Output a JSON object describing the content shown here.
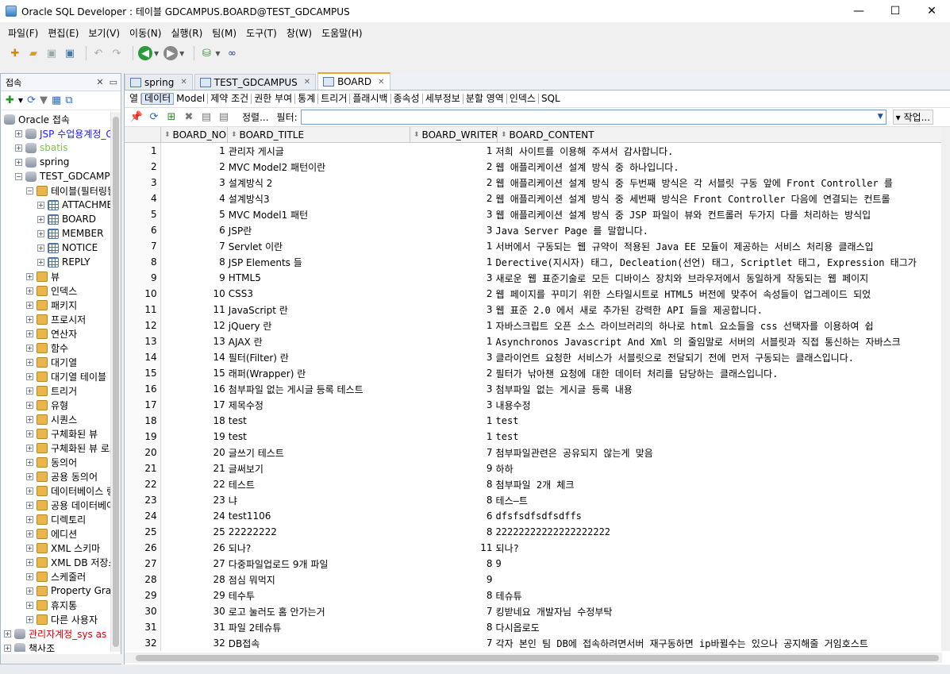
{
  "window": {
    "title": "Oracle SQL Developer : 테이블 GDCAMPUS.BOARD@TEST_GDCAMPUS",
    "minimize": "—",
    "maximize": "☐",
    "close": "✕"
  },
  "menu": [
    "파일(F)",
    "편집(E)",
    "보기(V)",
    "이동(N)",
    "실행(R)",
    "팀(M)",
    "도구(T)",
    "창(W)",
    "도움말(H)"
  ],
  "sidebar": {
    "title": "접속",
    "tree": [
      {
        "label": "Oracle 접속",
        "indent": 0,
        "icon": "db",
        "toggle": "",
        "color": "#000"
      },
      {
        "label": "JSP 수업용계정_GD",
        "indent": 1,
        "icon": "db",
        "toggle": "+",
        "color": "#1a1aff"
      },
      {
        "label": "sbatis",
        "indent": 1,
        "icon": "db",
        "toggle": "+",
        "color": "#7cc24a"
      },
      {
        "label": "spring",
        "indent": 1,
        "icon": "db",
        "toggle": "+",
        "color": "#000"
      },
      {
        "label": "TEST_GDCAMPUS",
        "indent": 1,
        "icon": "db",
        "toggle": "−",
        "color": "#000"
      },
      {
        "label": "테이블(필터링됨)",
        "indent": 2,
        "icon": "folder",
        "toggle": "−",
        "color": "#000"
      },
      {
        "label": "ATTACHMENT",
        "indent": 3,
        "icon": "table",
        "toggle": "+",
        "color": "#000"
      },
      {
        "label": "BOARD",
        "indent": 3,
        "icon": "table",
        "toggle": "+",
        "color": "#000"
      },
      {
        "label": "MEMBER",
        "indent": 3,
        "icon": "table",
        "toggle": "+",
        "color": "#000"
      },
      {
        "label": "NOTICE",
        "indent": 3,
        "icon": "table",
        "toggle": "+",
        "color": "#000"
      },
      {
        "label": "REPLY",
        "indent": 3,
        "icon": "table",
        "toggle": "+",
        "color": "#000"
      },
      {
        "label": "뷰",
        "indent": 2,
        "icon": "folder",
        "toggle": "+",
        "color": "#000"
      },
      {
        "label": "인덱스",
        "indent": 2,
        "icon": "folder",
        "toggle": "+",
        "color": "#000"
      },
      {
        "label": "패키지",
        "indent": 2,
        "icon": "folder",
        "toggle": "+",
        "color": "#000"
      },
      {
        "label": "프로시저",
        "indent": 2,
        "icon": "folder",
        "toggle": "+",
        "color": "#000"
      },
      {
        "label": "연산자",
        "indent": 2,
        "icon": "folder",
        "toggle": "+",
        "color": "#000"
      },
      {
        "label": "함수",
        "indent": 2,
        "icon": "folder",
        "toggle": "+",
        "color": "#000"
      },
      {
        "label": "대기열",
        "indent": 2,
        "icon": "folder",
        "toggle": "+",
        "color": "#000"
      },
      {
        "label": "대기열 테이블",
        "indent": 2,
        "icon": "folder",
        "toggle": "+",
        "color": "#000"
      },
      {
        "label": "트리거",
        "indent": 2,
        "icon": "folder",
        "toggle": "+",
        "color": "#000"
      },
      {
        "label": "유형",
        "indent": 2,
        "icon": "folder",
        "toggle": "+",
        "color": "#000"
      },
      {
        "label": "시퀀스",
        "indent": 2,
        "icon": "folder",
        "toggle": "+",
        "color": "#000"
      },
      {
        "label": "구체화된 뷰",
        "indent": 2,
        "icon": "folder",
        "toggle": "+",
        "color": "#000"
      },
      {
        "label": "구체화된 뷰 로그",
        "indent": 2,
        "icon": "folder",
        "toggle": "+",
        "color": "#000"
      },
      {
        "label": "동의어",
        "indent": 2,
        "icon": "folder",
        "toggle": "+",
        "color": "#000"
      },
      {
        "label": "공용 동의어",
        "indent": 2,
        "icon": "folder",
        "toggle": "+",
        "color": "#000"
      },
      {
        "label": "데이터베이스 링크",
        "indent": 2,
        "icon": "folder",
        "toggle": "+",
        "color": "#000"
      },
      {
        "label": "공용 데이터베이스",
        "indent": 2,
        "icon": "folder",
        "toggle": "+",
        "color": "#000"
      },
      {
        "label": "디렉토리",
        "indent": 2,
        "icon": "folder",
        "toggle": "+",
        "color": "#000"
      },
      {
        "label": "에디션",
        "indent": 2,
        "icon": "folder",
        "toggle": "+",
        "color": "#000"
      },
      {
        "label": "XML 스키마",
        "indent": 2,
        "icon": "folder",
        "toggle": "+",
        "color": "#000"
      },
      {
        "label": "XML DB 저장소",
        "indent": 2,
        "icon": "folder",
        "toggle": "+",
        "color": "#000"
      },
      {
        "label": "스케줄러",
        "indent": 2,
        "icon": "folder",
        "toggle": "+",
        "color": "#000"
      },
      {
        "label": "Property Graph",
        "indent": 2,
        "icon": "folder",
        "toggle": "+",
        "color": "#000"
      },
      {
        "label": "휴지통",
        "indent": 2,
        "icon": "folder",
        "toggle": "+",
        "color": "#000"
      },
      {
        "label": "다른 사용자",
        "indent": 2,
        "icon": "folder",
        "toggle": "+",
        "color": "#000"
      },
      {
        "label": "관리자계정_sys as",
        "indent": 0,
        "icon": "db",
        "toggle": "+",
        "color": "#e00000"
      },
      {
        "label": "책사조",
        "indent": 0,
        "icon": "db",
        "toggle": "+",
        "color": "#000"
      }
    ]
  },
  "doc_tabs": [
    {
      "label": "spring",
      "active": false
    },
    {
      "label": "TEST_GDCAMPUS",
      "active": false
    },
    {
      "label": "BOARD",
      "active": true
    }
  ],
  "sub_tabs": [
    "열",
    "데이터",
    "Model",
    "제약 조건",
    "권한 부여",
    "통계",
    "트리거",
    "플래시백",
    "종속성",
    "세부정보",
    "분할 영역",
    "인덱스",
    "SQL"
  ],
  "active_sub_tab": "데이터",
  "grid_toolbar": {
    "sort_label": "정렬...",
    "filter_label": "필터:",
    "filter_value": "",
    "job_label": "▾ 작업..."
  },
  "columns": [
    "",
    "BOARD_NO",
    "BOARD_TITLE",
    "BOARD_WRITER",
    "BOARD_CONTENT"
  ],
  "rows": [
    [
      "1",
      "1",
      "관리자 게시글",
      "1",
      "저희 사이트를 이용해 주셔서 감사합니다."
    ],
    [
      "2",
      "2",
      "MVC Model2 패턴이란",
      "2",
      "웹 애플리케이션 설계 방식 중 하나입니다."
    ],
    [
      "3",
      "3",
      "설계방식 2",
      "2",
      "웹 애플리케이션 설계 방식 중 두번째 방식은 각 서블릿 구동 앞에 Front Controller 를"
    ],
    [
      "4",
      "4",
      "설계방식3",
      "2",
      "웹 애플리케이션 설계 방식 중 세번째 방식은 Front Controller 다음에 연결되는 컨트롤"
    ],
    [
      "5",
      "5",
      "MVC Model1 패턴",
      "3",
      "웹 애플리케이션 설계 방식 중 JSP 파일이 뷰와 컨트롤러 두가지 다를 처리하는 방식입"
    ],
    [
      "6",
      "6",
      "JSP란",
      "3",
      "Java Server Page 를 말합니다."
    ],
    [
      "7",
      "7",
      "Servlet 이란",
      "1",
      "서버에서 구동되는 웹 규약이 적용된 Java EE 모듈이 제공하는 서비스 처리용 클래스입"
    ],
    [
      "8",
      "8",
      "JSP Elements 들",
      "1",
      "Derective(지시자) 태그, Decleation(선언) 태그, Scriptlet 태그, Expression 태그가"
    ],
    [
      "9",
      "9",
      "HTML5",
      "3",
      "새로운 웹 표준기술로 모든 디바이스 장치와 브라우저에서 동일하게 작동되는 웹 페이지"
    ],
    [
      "10",
      "10",
      "CSS3",
      "2",
      "웹 페이지를 꾸미기 위한 스타일시트로 HTML5 버전에 맞추어 속성들이 업그레이드 되었"
    ],
    [
      "11",
      "11",
      "JavaScript 란",
      "3",
      "웹 표준 2.0 에서 새로 추가된 강력한 API 들을 제공합니다."
    ],
    [
      "12",
      "12",
      "jQuery 란",
      "1",
      "자바스크립트 오픈 소스 라이브러리의 하나로 html 요소들을 css 선택자를 이용하여 쉽"
    ],
    [
      "13",
      "13",
      "AJAX 란",
      "1",
      "Asynchronos Javascript And Xml 의 줄임말로 서버의 서블릿과 직접 통신하는 자바스크"
    ],
    [
      "14",
      "14",
      "필터(Filter) 란",
      "3",
      "클라이언트 요청한 서비스가 서블릿으로 전달되기 전에 먼저 구동되는 클래스입니다."
    ],
    [
      "15",
      "15",
      "래퍼(Wrapper) 란",
      "2",
      "필터가 낚아챈 요청에 대한 데이터 처리를 담당하는 클래스입니다."
    ],
    [
      "16",
      "16",
      "첨부파일 없는 게시글 등록 테스트",
      "3",
      "첨부파일 없는 게시글 등록 내용"
    ],
    [
      "17",
      "17",
      "제목수정",
      "3",
      "내용수정"
    ],
    [
      "18",
      "18",
      "test",
      "1",
      "test"
    ],
    [
      "19",
      "19",
      "test",
      "1",
      "test"
    ],
    [
      "20",
      "20",
      "글쓰기 테스트",
      "7",
      "첨부파일관련은 공유되지 않는게 맞음"
    ],
    [
      "21",
      "21",
      "글써보기",
      "9",
      "하하"
    ],
    [
      "22",
      "22",
      "테스트",
      "8",
      "첨부파일 2개 체크"
    ],
    [
      "23",
      "23",
      "냐",
      "8",
      "테스—트"
    ],
    [
      "24",
      "24",
      "test1106",
      "6",
      "dfsfsdfsdfsdffs"
    ],
    [
      "25",
      "25",
      "22222222",
      "8",
      "22222222222222222222"
    ],
    [
      "26",
      "26",
      "되나?",
      "11",
      "되나?"
    ],
    [
      "27",
      "27",
      "다중파일업로드 9개 파일",
      "8",
      "9"
    ],
    [
      "28",
      "28",
      "점심 뭐먹지",
      "9",
      ""
    ],
    [
      "29",
      "29",
      "테수투",
      "8",
      "테슈튜"
    ],
    [
      "30",
      "30",
      "로고 눌러도 홈 안가는거",
      "7",
      "킹받네요 개발자님 수정부탁"
    ],
    [
      "31",
      "31",
      "파일 2테슈튜",
      "8",
      "다시옵로도"
    ],
    [
      "32",
      "32",
      "DB접속",
      "7",
      "각자 본인 팀 DB에 접속하려면서버 재구동하면 ip바뀔수는 있으나 공지해줄 거임호스트"
    ]
  ]
}
